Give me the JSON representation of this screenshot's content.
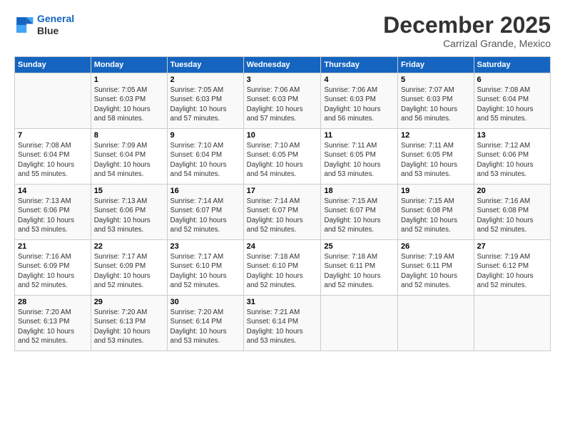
{
  "logo": {
    "line1": "General",
    "line2": "Blue"
  },
  "title": "December 2025",
  "subtitle": "Carrizal Grande, Mexico",
  "days_header": [
    "Sunday",
    "Monday",
    "Tuesday",
    "Wednesday",
    "Thursday",
    "Friday",
    "Saturday"
  ],
  "weeks": [
    [
      {
        "day": "",
        "text": ""
      },
      {
        "day": "1",
        "text": "Sunrise: 7:05 AM\nSunset: 6:03 PM\nDaylight: 10 hours\nand 58 minutes."
      },
      {
        "day": "2",
        "text": "Sunrise: 7:05 AM\nSunset: 6:03 PM\nDaylight: 10 hours\nand 57 minutes."
      },
      {
        "day": "3",
        "text": "Sunrise: 7:06 AM\nSunset: 6:03 PM\nDaylight: 10 hours\nand 57 minutes."
      },
      {
        "day": "4",
        "text": "Sunrise: 7:06 AM\nSunset: 6:03 PM\nDaylight: 10 hours\nand 56 minutes."
      },
      {
        "day": "5",
        "text": "Sunrise: 7:07 AM\nSunset: 6:03 PM\nDaylight: 10 hours\nand 56 minutes."
      },
      {
        "day": "6",
        "text": "Sunrise: 7:08 AM\nSunset: 6:04 PM\nDaylight: 10 hours\nand 55 minutes."
      }
    ],
    [
      {
        "day": "7",
        "text": "Sunrise: 7:08 AM\nSunset: 6:04 PM\nDaylight: 10 hours\nand 55 minutes."
      },
      {
        "day": "8",
        "text": "Sunrise: 7:09 AM\nSunset: 6:04 PM\nDaylight: 10 hours\nand 54 minutes."
      },
      {
        "day": "9",
        "text": "Sunrise: 7:10 AM\nSunset: 6:04 PM\nDaylight: 10 hours\nand 54 minutes."
      },
      {
        "day": "10",
        "text": "Sunrise: 7:10 AM\nSunset: 6:05 PM\nDaylight: 10 hours\nand 54 minutes."
      },
      {
        "day": "11",
        "text": "Sunrise: 7:11 AM\nSunset: 6:05 PM\nDaylight: 10 hours\nand 53 minutes."
      },
      {
        "day": "12",
        "text": "Sunrise: 7:11 AM\nSunset: 6:05 PM\nDaylight: 10 hours\nand 53 minutes."
      },
      {
        "day": "13",
        "text": "Sunrise: 7:12 AM\nSunset: 6:06 PM\nDaylight: 10 hours\nand 53 minutes."
      }
    ],
    [
      {
        "day": "14",
        "text": "Sunrise: 7:13 AM\nSunset: 6:06 PM\nDaylight: 10 hours\nand 53 minutes."
      },
      {
        "day": "15",
        "text": "Sunrise: 7:13 AM\nSunset: 6:06 PM\nDaylight: 10 hours\nand 53 minutes."
      },
      {
        "day": "16",
        "text": "Sunrise: 7:14 AM\nSunset: 6:07 PM\nDaylight: 10 hours\nand 52 minutes."
      },
      {
        "day": "17",
        "text": "Sunrise: 7:14 AM\nSunset: 6:07 PM\nDaylight: 10 hours\nand 52 minutes."
      },
      {
        "day": "18",
        "text": "Sunrise: 7:15 AM\nSunset: 6:07 PM\nDaylight: 10 hours\nand 52 minutes."
      },
      {
        "day": "19",
        "text": "Sunrise: 7:15 AM\nSunset: 6:08 PM\nDaylight: 10 hours\nand 52 minutes."
      },
      {
        "day": "20",
        "text": "Sunrise: 7:16 AM\nSunset: 6:08 PM\nDaylight: 10 hours\nand 52 minutes."
      }
    ],
    [
      {
        "day": "21",
        "text": "Sunrise: 7:16 AM\nSunset: 6:09 PM\nDaylight: 10 hours\nand 52 minutes."
      },
      {
        "day": "22",
        "text": "Sunrise: 7:17 AM\nSunset: 6:09 PM\nDaylight: 10 hours\nand 52 minutes."
      },
      {
        "day": "23",
        "text": "Sunrise: 7:17 AM\nSunset: 6:10 PM\nDaylight: 10 hours\nand 52 minutes."
      },
      {
        "day": "24",
        "text": "Sunrise: 7:18 AM\nSunset: 6:10 PM\nDaylight: 10 hours\nand 52 minutes."
      },
      {
        "day": "25",
        "text": "Sunrise: 7:18 AM\nSunset: 6:11 PM\nDaylight: 10 hours\nand 52 minutes."
      },
      {
        "day": "26",
        "text": "Sunrise: 7:19 AM\nSunset: 6:11 PM\nDaylight: 10 hours\nand 52 minutes."
      },
      {
        "day": "27",
        "text": "Sunrise: 7:19 AM\nSunset: 6:12 PM\nDaylight: 10 hours\nand 52 minutes."
      }
    ],
    [
      {
        "day": "28",
        "text": "Sunrise: 7:20 AM\nSunset: 6:13 PM\nDaylight: 10 hours\nand 52 minutes."
      },
      {
        "day": "29",
        "text": "Sunrise: 7:20 AM\nSunset: 6:13 PM\nDaylight: 10 hours\nand 53 minutes."
      },
      {
        "day": "30",
        "text": "Sunrise: 7:20 AM\nSunset: 6:14 PM\nDaylight: 10 hours\nand 53 minutes."
      },
      {
        "day": "31",
        "text": "Sunrise: 7:21 AM\nSunset: 6:14 PM\nDaylight: 10 hours\nand 53 minutes."
      },
      {
        "day": "",
        "text": ""
      },
      {
        "day": "",
        "text": ""
      },
      {
        "day": "",
        "text": ""
      }
    ]
  ]
}
